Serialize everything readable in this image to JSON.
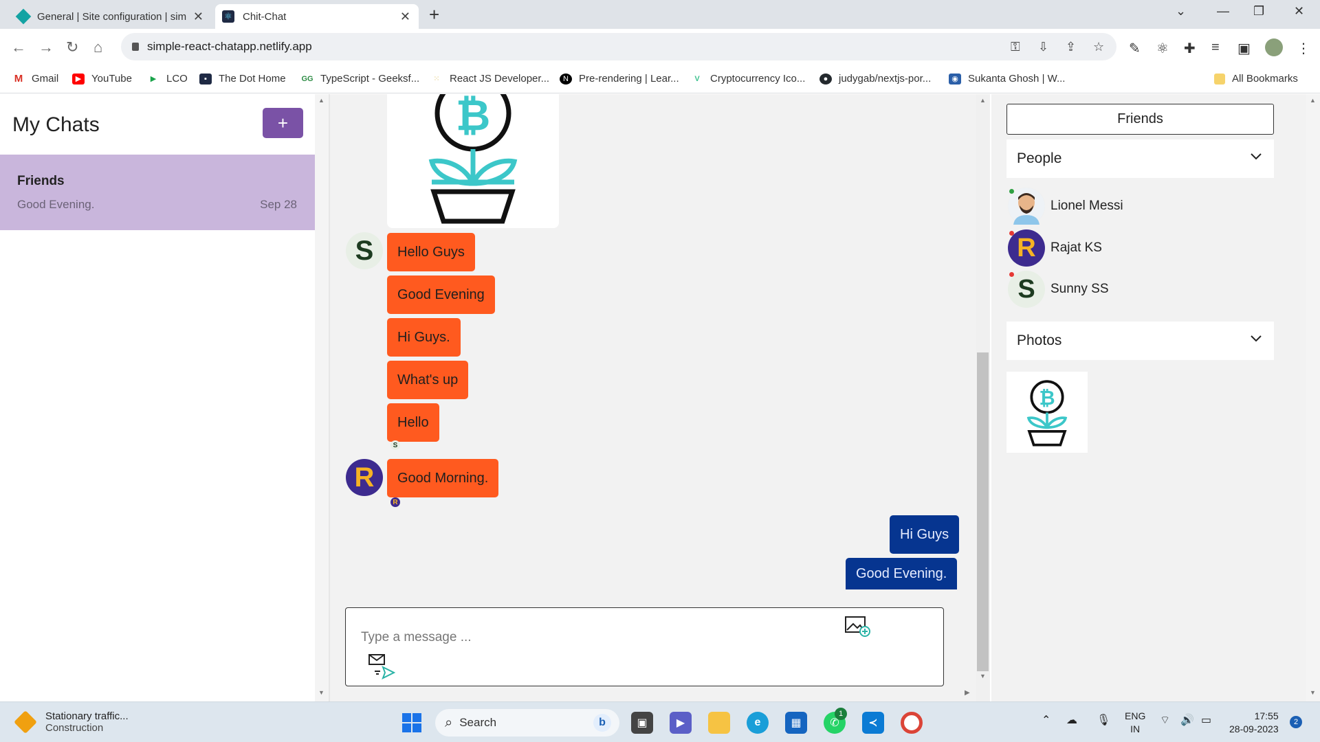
{
  "browser": {
    "tabs": [
      {
        "title": "General | Site configuration | sim",
        "active": false
      },
      {
        "title": "Chit-Chat",
        "active": true
      }
    ],
    "url": "simple-react-chatapp.netlify.app",
    "bookmarks": [
      {
        "label": "Gmail",
        "color": "#d93025"
      },
      {
        "label": "YouTube",
        "color": "#ff0000"
      },
      {
        "label": "LCO",
        "color": "#1aa34a"
      },
      {
        "label": "The Dot Home",
        "color": "#1f2a44"
      },
      {
        "label": "TypeScript - Geeksf...",
        "color": "#2f8d46"
      },
      {
        "label": "React JS Developer...",
        "color": "#e0c060"
      },
      {
        "label": "Pre-rendering | Lear...",
        "color": "#000000"
      },
      {
        "label": "Cryptocurrency Ico...",
        "color": "#3ec28f"
      },
      {
        "label": "judygab/nextjs-por...",
        "color": "#24292e"
      },
      {
        "label": "Sukanta Ghosh | W...",
        "color": "#2b5fa8"
      }
    ],
    "all_bookmarks": "All Bookmarks"
  },
  "sidebar": {
    "title": "My Chats",
    "add_label": "+",
    "chats": [
      {
        "name": "Friends",
        "last_message": "Good Evening.",
        "date": "Sep 28"
      }
    ]
  },
  "messages": [
    {
      "text": "Hello Guys"
    },
    {
      "text": "Good Evening"
    },
    {
      "text": "Hi Guys."
    },
    {
      "text": "What's up"
    },
    {
      "text": "Hello"
    },
    {
      "text": "Good Morning."
    },
    {
      "text": "Hi Guys"
    },
    {
      "text": "Good Evening."
    }
  ],
  "avatars": {
    "s_letter": "S",
    "r_letter": "R"
  },
  "composer": {
    "placeholder": "Type a message ..."
  },
  "details": {
    "title": "Friends",
    "people_label": "People",
    "people": [
      {
        "name": "Lionel Messi",
        "status_color": "#2ea043"
      },
      {
        "name": "Rajat KS",
        "status_color": "#e53935"
      },
      {
        "name": "Sunny SS",
        "status_color": "#e53935"
      }
    ],
    "photos_label": "Photos"
  },
  "taskbar": {
    "weather_title": "Stationary traffic...",
    "weather_sub": "Construction",
    "search_label": "Search",
    "whatsapp_badge": "1",
    "lang_1": "ENG",
    "lang_2": "IN",
    "time": "17:55",
    "date": "28-09-2023",
    "notifications": "2"
  },
  "colors": {
    "accent": "#7a52a6",
    "bubble_other": "#ff5a1f",
    "bubble_self": "#063590",
    "selected_chat": "#c9b6dc"
  }
}
